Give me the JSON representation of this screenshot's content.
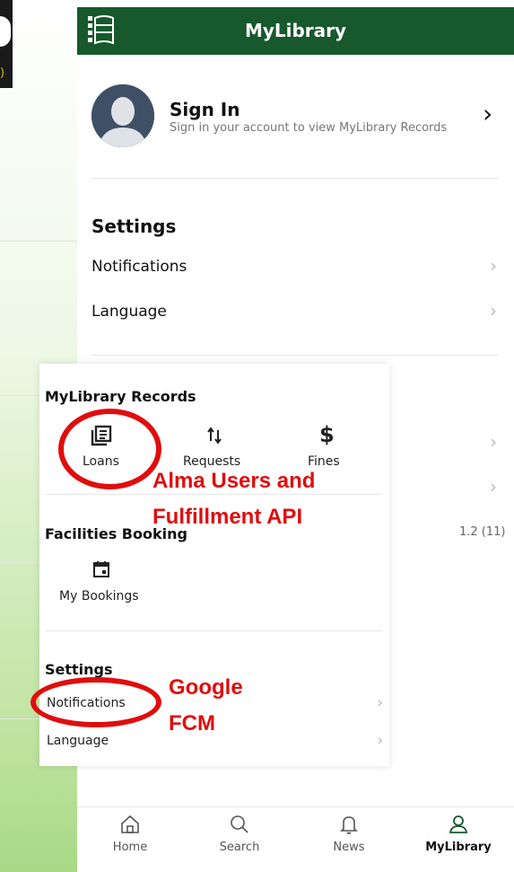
{
  "app": {
    "title": "MyLibrary"
  },
  "side": {
    "version_fragment": ")",
    "version": "1.2 (11)"
  },
  "signin": {
    "title": "Sign In",
    "subtitle": "Sign in your account to view MyLibrary Records",
    "chevron": "›"
  },
  "settings": {
    "heading": "Settings",
    "items": [
      {
        "label": "Notifications"
      },
      {
        "label": "Language"
      }
    ]
  },
  "overlay": {
    "records_heading": "MyLibrary Records",
    "records": [
      {
        "label": "Loans",
        "icon": "loans-icon"
      },
      {
        "label": "Requests",
        "icon": "requests-icon"
      },
      {
        "label": "Fines",
        "icon": "fines-icon",
        "glyph": "$"
      }
    ],
    "facilities_heading": "Facilities Booking",
    "bookings": {
      "label": "My Bookings",
      "icon": "calendar-icon"
    },
    "settings_heading": "Settings",
    "settings_items": [
      {
        "label": "Notifications"
      },
      {
        "label": "Language"
      }
    ]
  },
  "annotations": {
    "alma_line1": "Alma Users and",
    "alma_line2": "Fulfillment API",
    "google_line1": "Google",
    "google_line2": "FCM",
    "color": "#e00d0d"
  },
  "nav": [
    {
      "label": "Home",
      "icon": "home-icon"
    },
    {
      "label": "Search",
      "icon": "search-icon"
    },
    {
      "label": "News",
      "icon": "bell-icon"
    },
    {
      "label": "MyLibrary",
      "icon": "user-icon",
      "active": true
    }
  ],
  "colors": {
    "header": "#17582c",
    "accent": "#17582c",
    "annotation": "#e00d0d"
  }
}
